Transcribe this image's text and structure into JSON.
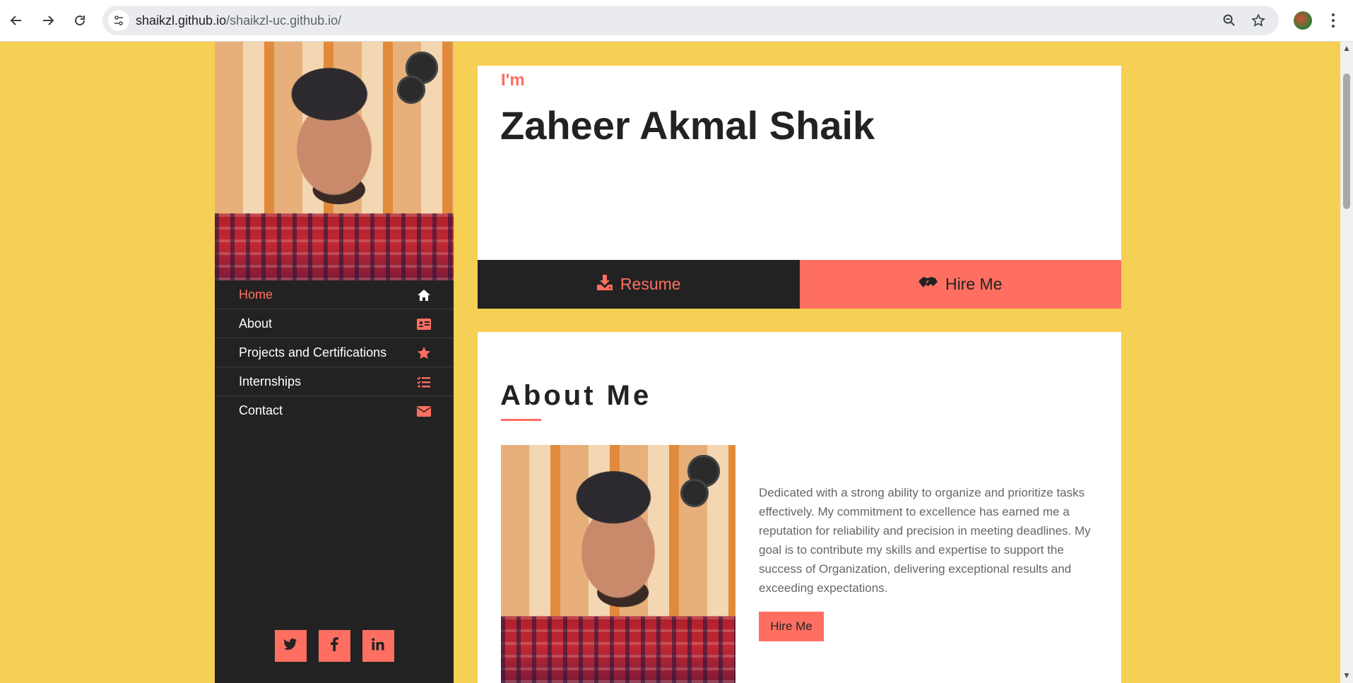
{
  "browser": {
    "url_host": "shaikzl.github.io",
    "url_path": "/shaikzl-uc.github.io/",
    "icons": {
      "back": "arrow-left-icon",
      "forward": "arrow-right-icon",
      "reload": "reload-icon",
      "site_info": "tune-icon",
      "zoom": "zoom-icon",
      "bookmark": "star-outline-icon",
      "profile": "profile-avatar",
      "menu": "kebab-menu-icon"
    }
  },
  "sidebar": {
    "nav": [
      {
        "label": "Home",
        "icon": "home-icon",
        "active": true
      },
      {
        "label": "About",
        "icon": "id-card-icon",
        "active": false
      },
      {
        "label": "Projects and Certifications",
        "icon": "star-icon",
        "active": false
      },
      {
        "label": "Internships",
        "icon": "list-check-icon",
        "active": false
      },
      {
        "label": "Contact",
        "icon": "envelope-icon",
        "active": false
      }
    ],
    "socials": [
      {
        "icon": "twitter-icon",
        "glyph": "t"
      },
      {
        "icon": "facebook-icon",
        "glyph": "f"
      },
      {
        "icon": "linkedin-icon",
        "glyph": "in"
      }
    ]
  },
  "hero": {
    "intro": "I'm",
    "name": "Zaheer Akmal Shaik",
    "resume_label": "Resume",
    "hire_label": "Hire Me"
  },
  "about": {
    "heading": "About Me",
    "bio": "Dedicated with a strong ability to organize and prioritize tasks effectively. My commitment to excellence has earned me a reputation for reliability and precision in meeting deadlines. My goal is to contribute my skills and expertise to support the success of Organization, delivering exceptional results and exceeding expectations.",
    "hire_label": "Hire Me"
  },
  "colors": {
    "background": "#f6cf55",
    "accent": "#ff6f61",
    "dark": "#222222",
    "text_muted": "#666666"
  }
}
